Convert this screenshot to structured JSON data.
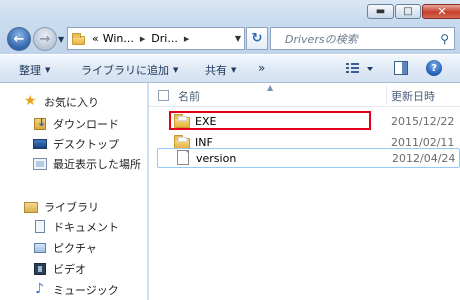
{
  "window": {
    "minimize_glyph": "▬",
    "maximize_glyph": "□",
    "close_glyph": "✕"
  },
  "address_bar": {
    "prefix": "«",
    "crumbs": [
      "Win...",
      "Dri..."
    ],
    "search_placeholder": "Driversの検索"
  },
  "toolbar": {
    "organize": "整理",
    "add_to_library": "ライブラリに追加",
    "share": "共有",
    "more": "»",
    "help": "?"
  },
  "navigation": {
    "favorites_header": "お気に入り",
    "favorites": [
      "ダウンロード",
      "デスクトップ",
      "最近表示した場所"
    ],
    "libraries_header": "ライブラリ",
    "libraries": [
      "ドキュメント",
      "ピクチャ",
      "ビデオ",
      "ミュージック"
    ]
  },
  "columns": {
    "name": "名前",
    "date_modified": "更新日時"
  },
  "files": [
    {
      "name": "EXE",
      "date": "2015/12/22",
      "type": "folder",
      "highlighted": true
    },
    {
      "name": "INF",
      "date": "2011/02/11",
      "type": "folder",
      "highlighted": false
    },
    {
      "name": "version",
      "date": "2012/04/24",
      "type": "file",
      "highlighted": false
    }
  ],
  "colors": {
    "highlight_border": "#e4001b",
    "selection_border": "#99c8f4",
    "chrome_bg": "#c9dbee"
  },
  "icons": {
    "back": "back-arrow-icon",
    "forward": "forward-arrow-icon",
    "refresh": "refresh-icon",
    "search": "search-icon",
    "folder": "folder-icon",
    "file": "file-icon"
  }
}
